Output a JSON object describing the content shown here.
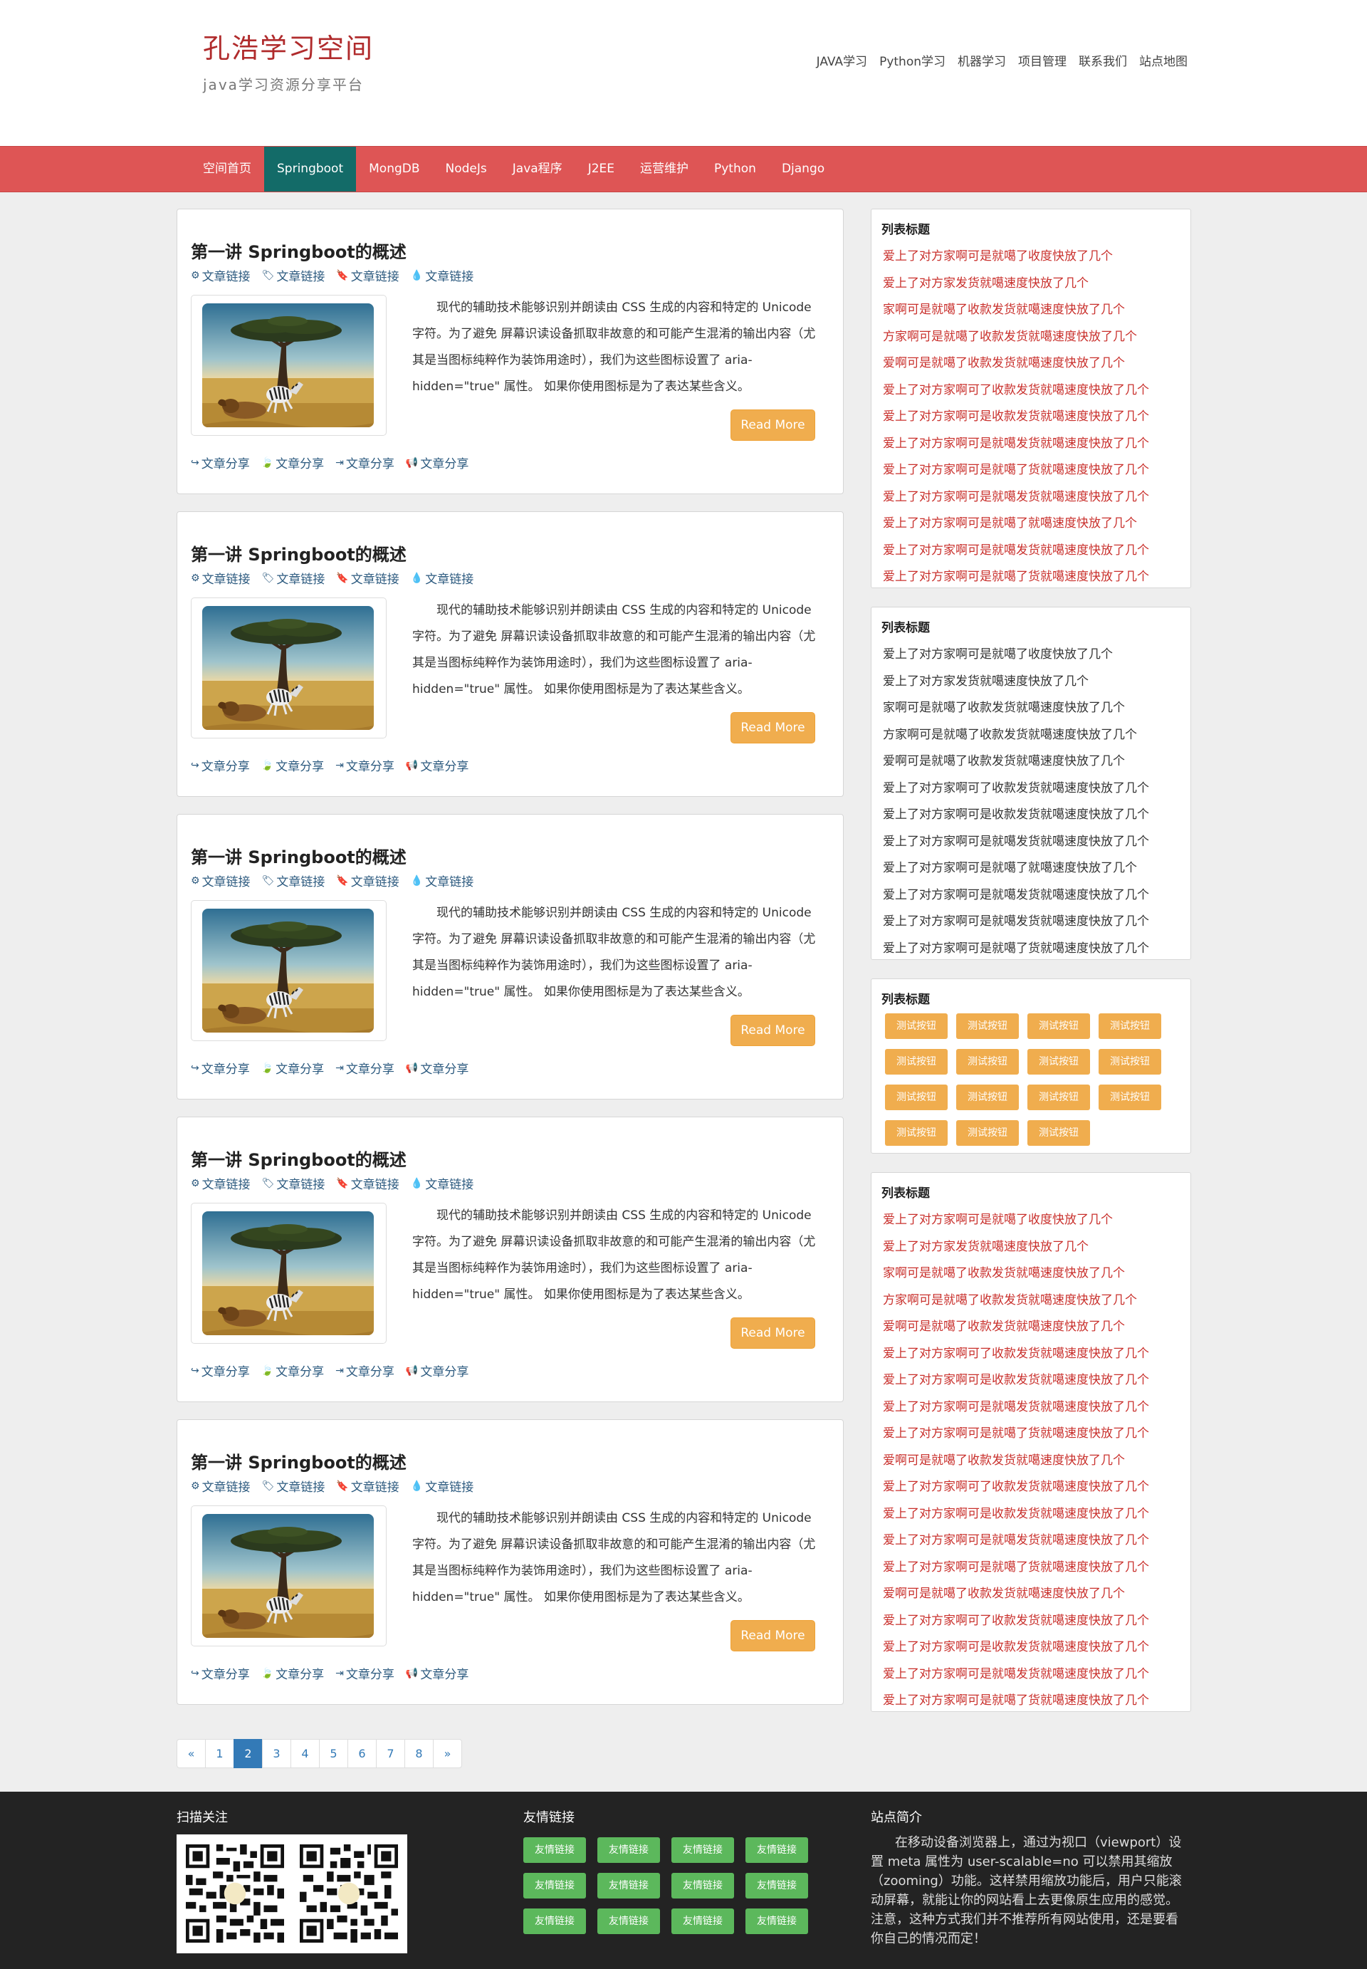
{
  "header": {
    "site_title": "孔浩学习空间",
    "site_subtitle": "java学习资源分享平台",
    "top_links": [
      "JAVA学习",
      "Python学习",
      "机器学习",
      "项目管理",
      "联系我们",
      "站点地图"
    ]
  },
  "nav": {
    "items": [
      "空间首页",
      "Springboot",
      "MongDB",
      "NodeJs",
      "Java程序",
      "J2EE",
      "运营维护",
      "Python",
      "Django"
    ],
    "active": "Springboot"
  },
  "articles": [
    {
      "title": "第一讲 Springboot的概述",
      "meta": [
        {
          "icon": "gear-icon",
          "label": "文章链接"
        },
        {
          "icon": "tags-icon",
          "label": "文章链接"
        },
        {
          "icon": "bookmark-icon",
          "label": "文章链接"
        },
        {
          "icon": "tint-icon",
          "label": "文章链接"
        }
      ],
      "excerpt": "现代的辅助技术能够识别并朗读由 CSS 生成的内容和特定的 Unicode 字符。为了避免 屏幕识读设备抓取非故意的和可能产生混淆的输出内容（尤其是当图标纯粹作为装饰用途时），我们为这些图标设置了 aria-hidden=\"true\" 属性。 如果你使用图标是为了表达某些含义。",
      "read_more": "Read More",
      "shares": [
        {
          "icon": "share-icon",
          "label": "文章分享"
        },
        {
          "icon": "leaf-icon",
          "label": "文章分享"
        },
        {
          "icon": "sign-out-icon",
          "label": "文章分享"
        },
        {
          "icon": "bullhorn-icon",
          "label": "文章分享"
        }
      ]
    },
    {
      "title": "第一讲 Springboot的概述",
      "meta": [
        {
          "icon": "gear-icon",
          "label": "文章链接"
        },
        {
          "icon": "tags-icon",
          "label": "文章链接"
        },
        {
          "icon": "bookmark-icon",
          "label": "文章链接"
        },
        {
          "icon": "tint-icon",
          "label": "文章链接"
        }
      ],
      "excerpt": "现代的辅助技术能够识别并朗读由 CSS 生成的内容和特定的 Unicode 字符。为了避免 屏幕识读设备抓取非故意的和可能产生混淆的输出内容（尤其是当图标纯粹作为装饰用途时），我们为这些图标设置了 aria-hidden=\"true\" 属性。 如果你使用图标是为了表达某些含义。",
      "read_more": "Read More",
      "shares": [
        {
          "icon": "share-icon",
          "label": "文章分享"
        },
        {
          "icon": "leaf-icon",
          "label": "文章分享"
        },
        {
          "icon": "sign-out-icon",
          "label": "文章分享"
        },
        {
          "icon": "bullhorn-icon",
          "label": "文章分享"
        }
      ]
    },
    {
      "title": "第一讲 Springboot的概述",
      "meta": [
        {
          "icon": "gear-icon",
          "label": "文章链接"
        },
        {
          "icon": "tags-icon",
          "label": "文章链接"
        },
        {
          "icon": "bookmark-icon",
          "label": "文章链接"
        },
        {
          "icon": "tint-icon",
          "label": "文章链接"
        }
      ],
      "excerpt": "现代的辅助技术能够识别并朗读由 CSS 生成的内容和特定的 Unicode 字符。为了避免 屏幕识读设备抓取非故意的和可能产生混淆的输出内容（尤其是当图标纯粹作为装饰用途时），我们为这些图标设置了 aria-hidden=\"true\" 属性。 如果你使用图标是为了表达某些含义。",
      "read_more": "Read More",
      "shares": [
        {
          "icon": "share-icon",
          "label": "文章分享"
        },
        {
          "icon": "leaf-icon",
          "label": "文章分享"
        },
        {
          "icon": "sign-out-icon",
          "label": "文章分享"
        },
        {
          "icon": "bullhorn-icon",
          "label": "文章分享"
        }
      ]
    },
    {
      "title": "第一讲 Springboot的概述",
      "meta": [
        {
          "icon": "gear-icon",
          "label": "文章链接"
        },
        {
          "icon": "tags-icon",
          "label": "文章链接"
        },
        {
          "icon": "bookmark-icon",
          "label": "文章链接"
        },
        {
          "icon": "tint-icon",
          "label": "文章链接"
        }
      ],
      "excerpt": "现代的辅助技术能够识别并朗读由 CSS 生成的内容和特定的 Unicode 字符。为了避免 屏幕识读设备抓取非故意的和可能产生混淆的输出内容（尤其是当图标纯粹作为装饰用途时），我们为这些图标设置了 aria-hidden=\"true\" 属性。 如果你使用图标是为了表达某些含义。",
      "read_more": "Read More",
      "shares": [
        {
          "icon": "share-icon",
          "label": "文章分享"
        },
        {
          "icon": "leaf-icon",
          "label": "文章分享"
        },
        {
          "icon": "sign-out-icon",
          "label": "文章分享"
        },
        {
          "icon": "bullhorn-icon",
          "label": "文章分享"
        }
      ]
    },
    {
      "title": "第一讲 Springboot的概述",
      "meta": [
        {
          "icon": "gear-icon",
          "label": "文章链接"
        },
        {
          "icon": "tags-icon",
          "label": "文章链接"
        },
        {
          "icon": "bookmark-icon",
          "label": "文章链接"
        },
        {
          "icon": "tint-icon",
          "label": "文章链接"
        }
      ],
      "excerpt": "现代的辅助技术能够识别并朗读由 CSS 生成的内容和特定的 Unicode 字符。为了避免 屏幕识读设备抓取非故意的和可能产生混淆的输出内容（尤其是当图标纯粹作为装饰用途时），我们为这些图标设置了 aria-hidden=\"true\" 属性。 如果你使用图标是为了表达某些含义。",
      "read_more": "Read More",
      "shares": [
        {
          "icon": "share-icon",
          "label": "文章分享"
        },
        {
          "icon": "leaf-icon",
          "label": "文章分享"
        },
        {
          "icon": "sign-out-icon",
          "label": "文章分享"
        },
        {
          "icon": "bullhorn-icon",
          "label": "文章分享"
        }
      ]
    }
  ],
  "pagination": {
    "prev": "«",
    "pages": [
      "1",
      "2",
      "3",
      "4",
      "5",
      "6",
      "7",
      "8"
    ],
    "current": "2",
    "next": "»"
  },
  "sidebar": {
    "panel1": {
      "title": "列表标题",
      "items": [
        "爱上了对方家啊可是就噶了收度快放了几个",
        "爱上了对方家发货就噶速度快放了几个",
        "家啊可是就噶了收款发货就噶速度快放了几个",
        "方家啊可是就噶了收款发货就噶速度快放了几个",
        "爱啊可是就噶了收款发货就噶速度快放了几个",
        "爱上了对方家啊可了收款发货就噶速度快放了几个",
        "爱上了对方家啊可是收款发货就噶速度快放了几个",
        "爱上了对方家啊可是就噶发货就噶速度快放了几个",
        "爱上了对方家啊可是就噶了货就噶速度快放了几个",
        "爱上了对方家啊可是就噶发货就噶速度快放了几个",
        "爱上了对方家啊可是就噶了就噶速度快放了几个",
        "爱上了对方家啊可是就噶发货就噶速度快放了几个",
        "爱上了对方家啊可是就噶了货就噶速度快放了几个"
      ]
    },
    "panel2": {
      "title": "列表标题",
      "items": [
        "爱上了对方家啊可是就噶了收度快放了几个",
        "爱上了对方家发货就噶速度快放了几个",
        "家啊可是就噶了收款发货就噶速度快放了几个",
        "方家啊可是就噶了收款发货就噶速度快放了几个",
        "爱啊可是就噶了收款发货就噶速度快放了几个",
        "爱上了对方家啊可了收款发货就噶速度快放了几个",
        "爱上了对方家啊可是收款发货就噶速度快放了几个",
        "爱上了对方家啊可是就噶发货就噶速度快放了几个",
        "爱上了对方家啊可是就噶了就噶速度快放了几个",
        "爱上了对方家啊可是就噶发货就噶速度快放了几个",
        "爱上了对方家啊可是就噶发货就噶速度快放了几个",
        "爱上了对方家啊可是就噶了货就噶速度快放了几个"
      ]
    },
    "panel3": {
      "title": "列表标题",
      "buttons": [
        "测试按钮",
        "测试按钮",
        "测试按钮",
        "测试按钮",
        "测试按钮",
        "测试按钮",
        "测试按钮",
        "测试按钮",
        "测试按钮",
        "测试按钮",
        "测试按钮",
        "测试按钮",
        "测试按钮",
        "测试按钮",
        "测试按钮"
      ]
    },
    "panel4": {
      "title": "列表标题",
      "items": [
        "爱上了对方家啊可是就噶了收度快放了几个",
        "爱上了对方家发货就噶速度快放了几个",
        "家啊可是就噶了收款发货就噶速度快放了几个",
        "方家啊可是就噶了收款发货就噶速度快放了几个",
        "爱啊可是就噶了收款发货就噶速度快放了几个",
        "爱上了对方家啊可了收款发货就噶速度快放了几个",
        "爱上了对方家啊可是收款发货就噶速度快放了几个",
        "爱上了对方家啊可是就噶发货就噶速度快放了几个",
        "爱上了对方家啊可是就噶了货就噶速度快放了几个",
        "爱啊可是就噶了收款发货就噶速度快放了几个",
        "爱上了对方家啊可了收款发货就噶速度快放了几个",
        "爱上了对方家啊可是收款发货就噶速度快放了几个",
        "爱上了对方家啊可是就噶发货就噶速度快放了几个",
        "爱上了对方家啊可是就噶了货就噶速度快放了几个",
        "爱啊可是就噶了收款发货就噶速度快放了几个",
        "爱上了对方家啊可了收款发货就噶速度快放了几个",
        "爱上了对方家啊可是收款发货就噶速度快放了几个",
        "爱上了对方家啊可是就噶发货就噶速度快放了几个",
        "爱上了对方家啊可是就噶了货就噶速度快放了几个"
      ]
    }
  },
  "footer": {
    "scan_title": "扫描关注",
    "links_title": "友情链接",
    "links": [
      "友情链接",
      "友情链接",
      "友情链接",
      "友情链接",
      "友情链接",
      "友情链接",
      "友情链接",
      "友情链接",
      "友情链接",
      "友情链接",
      "友情链接",
      "友情链接"
    ],
    "about_title": "站点简介",
    "about_text": "在移动设备浏览器上，通过为视口（viewport）设置 meta 属性为 user-scalable=no 可以禁用其缩放（zooming）功能。这样禁用缩放功能后，用户只能滚动屏幕，就能让你的网站看上去更像原生应用的感觉。注意，这种方式我们并不推荐所有网站使用，还是要看你自己的情况而定！"
  },
  "colors": {
    "navbar": "#de5555",
    "nav_active": "#136b68",
    "brand_title": "#b02b2c",
    "read_more": "#f0ad4e",
    "friend_link": "#5cb85c",
    "footer_bg": "#232323",
    "pagination_active": "#337ab7"
  }
}
